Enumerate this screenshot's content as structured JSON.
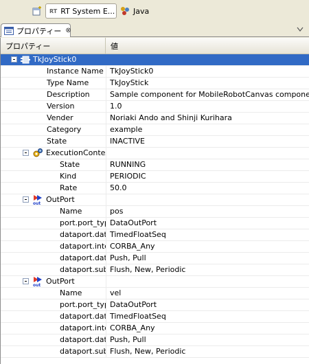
{
  "toolbar": {
    "perspective_label": "RT System E...",
    "perspective_logo": "RT",
    "java_label": "Java"
  },
  "view": {
    "tab_title": "プロパティー",
    "tab_close": "⊗"
  },
  "table": {
    "header": {
      "property": "プロパティー",
      "value": "値"
    },
    "root": {
      "label": "TkJoyStick0"
    },
    "component_props": [
      {
        "name": "Instance Name",
        "value": "TkJoyStick0"
      },
      {
        "name": "Type Name",
        "value": "TkJoyStick"
      },
      {
        "name": "Description",
        "value": "Sample component for MobileRobotCanvas component"
      },
      {
        "name": "Version",
        "value": "1.0"
      },
      {
        "name": "Vender",
        "value": "Noriaki Ando and Shinji Kurihara"
      },
      {
        "name": "Category",
        "value": "example"
      },
      {
        "name": "State",
        "value": "INACTIVE"
      }
    ],
    "exec_context": {
      "label": "ExecutionContex",
      "props": [
        {
          "name": "State",
          "value": "RUNNING"
        },
        {
          "name": "Kind",
          "value": "PERIODIC"
        },
        {
          "name": "Rate",
          "value": "50.0"
        }
      ]
    },
    "outports": [
      {
        "label": "OutPort",
        "props": [
          {
            "name": "Name",
            "value": "pos"
          },
          {
            "name": "port.port_type",
            "value": "DataOutPort"
          },
          {
            "name": "dataport.data_",
            "value": "TimedFloatSeq"
          },
          {
            "name": "dataport.inter",
            "value": "CORBA_Any"
          },
          {
            "name": "dataport.dataf",
            "value": "Push, Pull"
          },
          {
            "name": "dataport.subs",
            "value": "Flush, New, Periodic"
          }
        ]
      },
      {
        "label": "OutPort",
        "props": [
          {
            "name": "Name",
            "value": "vel"
          },
          {
            "name": "port.port_type",
            "value": "DataOutPort"
          },
          {
            "name": "dataport.data_",
            "value": "TimedFloatSeq"
          },
          {
            "name": "dataport.inter",
            "value": "CORBA_Any"
          },
          {
            "name": "dataport.dataf",
            "value": "Push, Pull"
          },
          {
            "name": "dataport.subs",
            "value": "Flush, New, Periodic"
          }
        ]
      }
    ],
    "icons": {
      "component": "component-icon",
      "exec_context": "gears-icon",
      "outport": "outport-icon"
    },
    "colors": {
      "selection": "#316ac5",
      "outport_red": "#e03a2a",
      "outport_blue": "#1f3fc8"
    }
  }
}
